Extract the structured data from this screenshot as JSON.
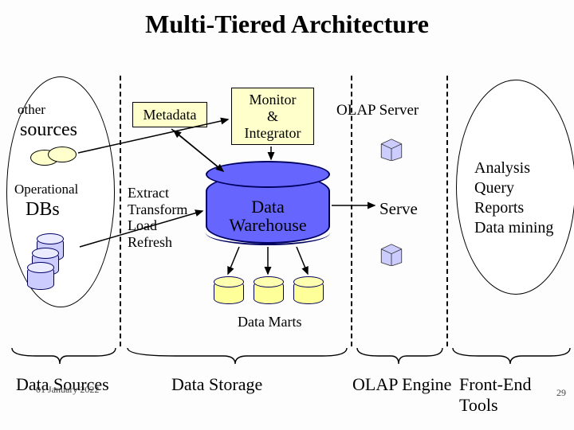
{
  "title": "Multi-Tiered Architecture",
  "left_oval": {
    "other": "other",
    "sources": "sources",
    "operational": "Operational",
    "dbs": "DBs"
  },
  "metadata_label": "Metadata",
  "monitor": {
    "l1": "Monitor",
    "l2": "&",
    "l3": "Integrator"
  },
  "etl": {
    "l1": "Extract",
    "l2": "Transform",
    "l3": "Load",
    "l4": "Refresh"
  },
  "data_warehouse": {
    "l1": "Data",
    "l2": "Warehouse"
  },
  "olap_server_label": "OLAP Server",
  "serve_label": "Serve",
  "right_oval": {
    "l1": "Analysis",
    "l2": "Query",
    "l3": "Reports",
    "l4": "Data mining"
  },
  "data_marts_label": "Data Marts",
  "tiers": {
    "t1": "Data Sources",
    "t2": "Data Storage",
    "t3": "OLAP Engine",
    "t4": "Front-End Tools"
  },
  "footer": {
    "date": "01 January 2022",
    "page": "29"
  },
  "colors": {
    "yellow": "#ffffcc",
    "purple": "#ccccff",
    "blue": "#6666ff"
  }
}
